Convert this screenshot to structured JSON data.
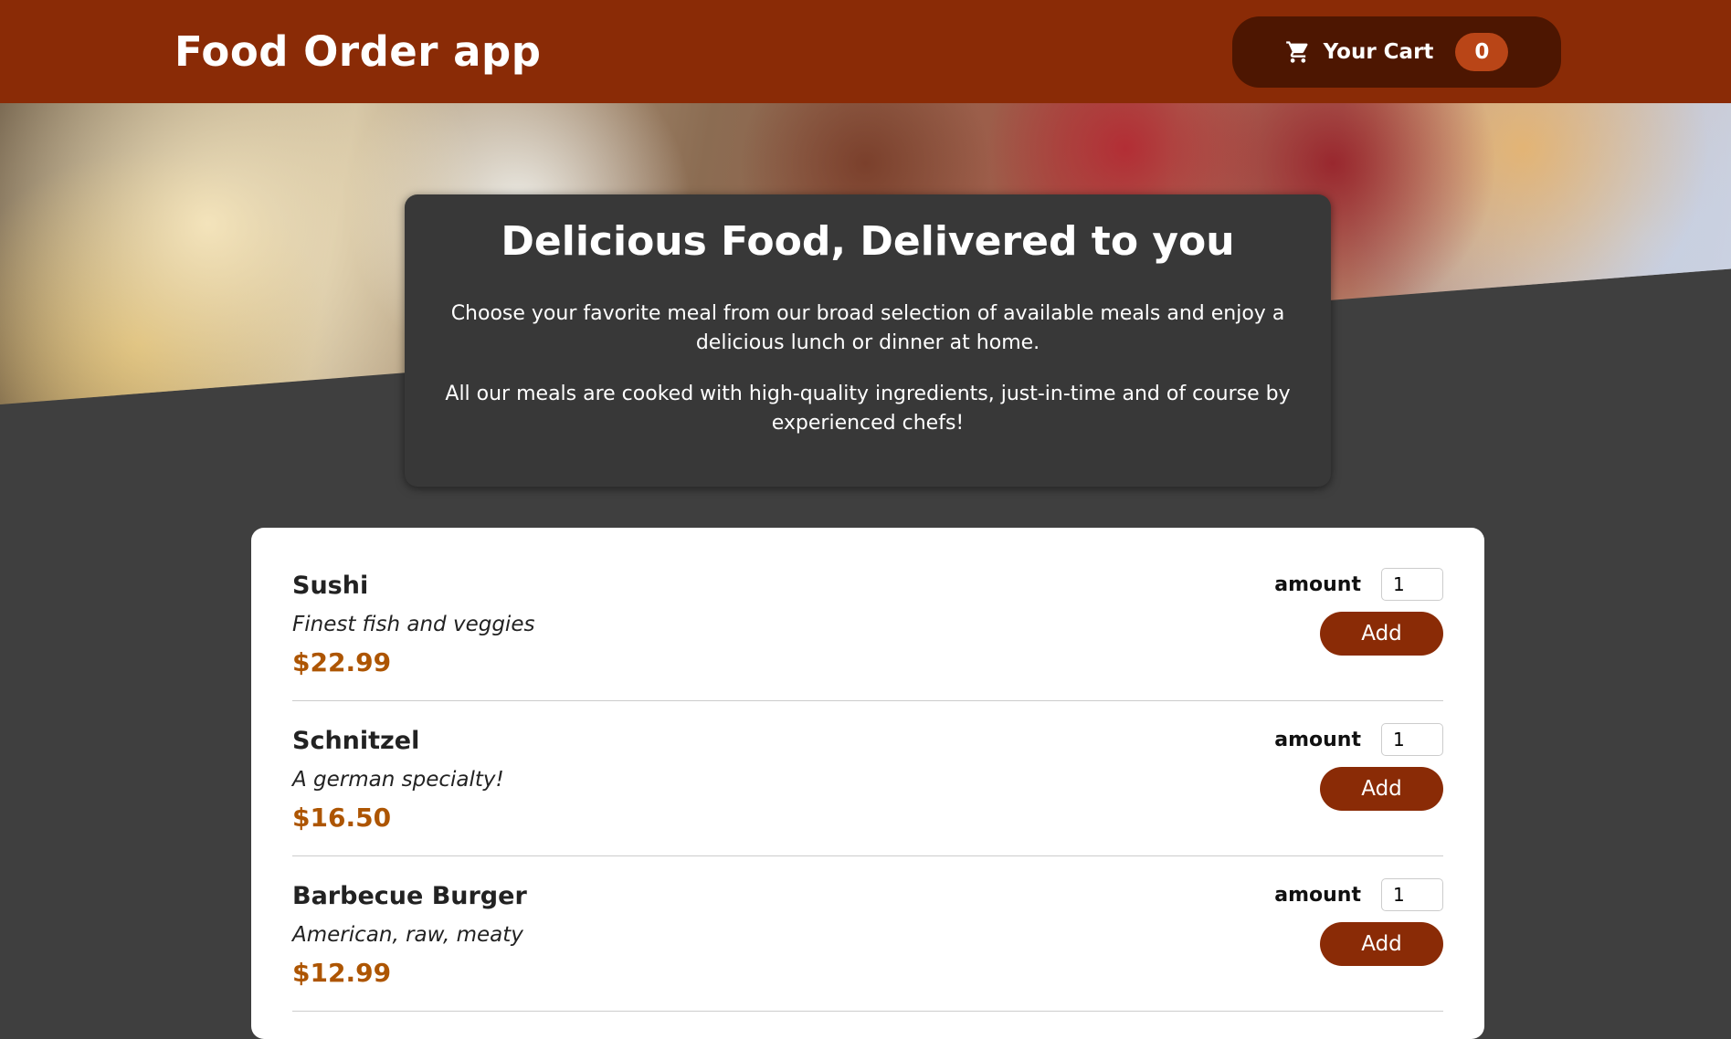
{
  "header": {
    "title": "Food Order app",
    "cart_label": "Your Cart",
    "cart_count": "0"
  },
  "summary": {
    "heading": "Delicious Food, Delivered to you",
    "paragraph1": "Choose your favorite meal from our broad selection of available meals and enjoy a delicious lunch or dinner at home.",
    "paragraph2": "All our meals are cooked with high-quality ingredients, just-in-time and of course by experienced chefs!"
  },
  "meals": [
    {
      "name": "Sushi",
      "description": "Finest fish and veggies",
      "price": "$22.99",
      "amount_label": "amount",
      "amount_value": "1",
      "add_label": "Add"
    },
    {
      "name": "Schnitzel",
      "description": "A german specialty!",
      "price": "$16.50",
      "amount_label": "amount",
      "amount_value": "1",
      "add_label": "Add"
    },
    {
      "name": "Barbecue Burger",
      "description": "American, raw, meaty",
      "price": "$12.99",
      "amount_label": "amount",
      "amount_value": "1",
      "add_label": "Add"
    }
  ],
  "colors": {
    "header": "#8a2b06",
    "cart_button": "#4d1601",
    "badge": "#b94517",
    "price": "#ad5502",
    "background": "#3f3f3f"
  },
  "icons": {
    "cart": "cart-icon"
  }
}
